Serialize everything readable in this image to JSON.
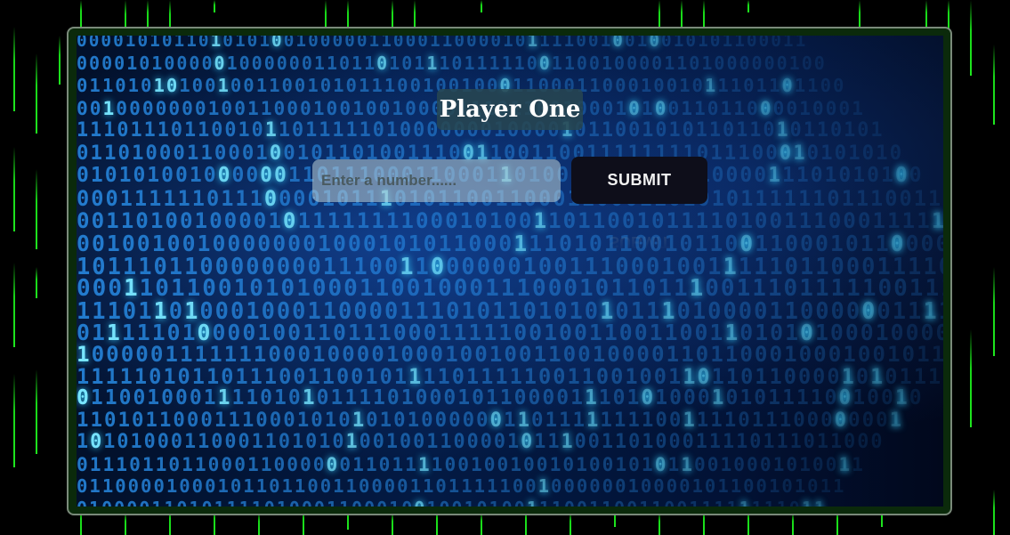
{
  "title": "Player One",
  "number_input": {
    "placeholder": "Enter a number......",
    "value": ""
  },
  "submit_button": {
    "label": "SUBMIT"
  },
  "colors": {
    "page_background": "#000000",
    "rain_green": "#1fe81f",
    "frame_border": "#7a8a7a",
    "title_background": "#284650",
    "button_background": "#0e0e1a"
  },
  "background_image": "blue-binary-code-icon"
}
